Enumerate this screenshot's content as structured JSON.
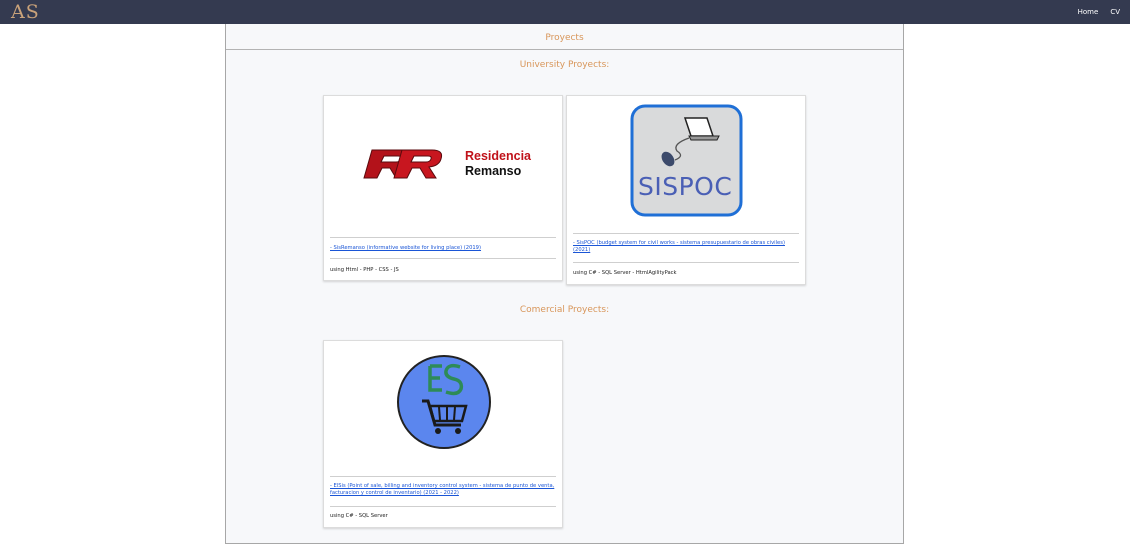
{
  "nav": {
    "brand": "AS",
    "links": [
      "Home",
      "CV"
    ]
  },
  "page": {
    "title": "Proyects",
    "university_title": "University Proyects:",
    "commercial_title": "Comercial Proyects:"
  },
  "projects": {
    "university": [
      {
        "logo": "residencia-remanso-logo",
        "logo_text": [
          "Residencia",
          "Remanso"
        ],
        "link": "- SisRemanso (informative website for living place) (2019)",
        "tech": "using Html - PHP - CSS - JS"
      },
      {
        "logo": "sispoc-logo",
        "logo_text": "SISPOC",
        "link": "- SisPOC (budget system for civil works - sistema presupuestario de obras civiles) (2021)",
        "tech": "using C# - SQL Server - HtmlAgilityPack"
      }
    ],
    "commercial": [
      {
        "logo": "elsis-logo",
        "link": "- ElSis (Point of sale, billing and inventory control system - sistema de punto de venta, facturacion y control de inventario) (2021 - 2022)",
        "tech": "using C# - SQL Server"
      }
    ]
  },
  "colors": {
    "navbar": "#343a50",
    "accent": "#d8965a",
    "link": "#1a55d6",
    "rr_red": "#c0121a",
    "sispoc_blue": "#1f6fd6",
    "elsis_blue": "#5b86ee",
    "elsis_green": "#2e8b57"
  }
}
